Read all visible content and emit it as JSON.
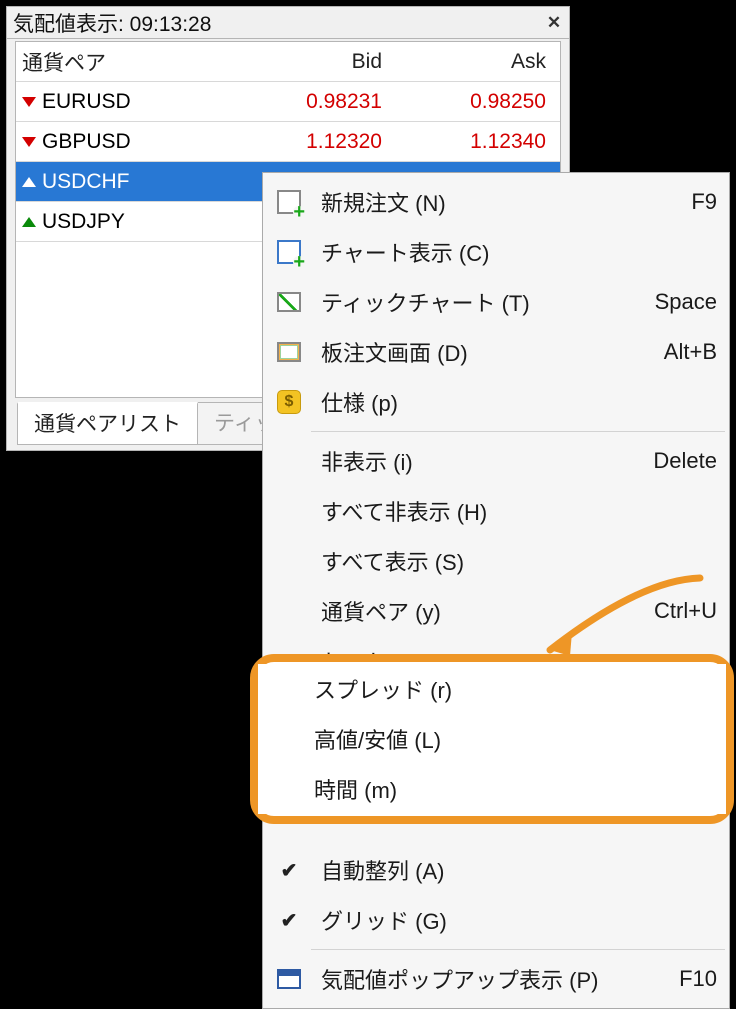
{
  "window": {
    "title": "気配値表示: 09:13:28"
  },
  "table": {
    "headers": {
      "symbol": "通貨ペア",
      "bid": "Bid",
      "ask": "Ask"
    },
    "rows": [
      {
        "symbol": "EURUSD",
        "bid": "0.98231",
        "ask": "0.98250",
        "direction": "down",
        "selected": false
      },
      {
        "symbol": "GBPUSD",
        "bid": "1.12320",
        "ask": "1.12340",
        "direction": "down",
        "selected": false
      },
      {
        "symbol": "USDCHF",
        "bid": "",
        "ask": "",
        "direction": "up",
        "selected": true
      },
      {
        "symbol": "USDJPY",
        "bid": "",
        "ask": "",
        "direction": "up",
        "selected": false
      }
    ]
  },
  "tabs": {
    "active": "通貨ペアリスト",
    "inactive": "ティッ"
  },
  "menu": {
    "items": [
      {
        "icon": "order-icon",
        "label": "新規注文 (N)",
        "shortcut": "F9"
      },
      {
        "icon": "chart-icon",
        "label": "チャート表示 (C)",
        "shortcut": ""
      },
      {
        "icon": "tick-icon",
        "label": "ティックチャート (T)",
        "shortcut": "Space"
      },
      {
        "icon": "dom-icon",
        "label": "板注文画面 (D)",
        "shortcut": "Alt+B"
      },
      {
        "icon": "spec-icon",
        "label": "仕様 (p)",
        "shortcut": ""
      }
    ],
    "group2": [
      {
        "label": "非表示 (i)",
        "shortcut": "Delete"
      },
      {
        "label": "すべて非表示 (H)",
        "shortcut": ""
      },
      {
        "label": "すべて表示 (S)",
        "shortcut": ""
      },
      {
        "label": "通貨ペア (y)",
        "shortcut": "Ctrl+U"
      },
      {
        "label": "セット",
        "submenu": true
      }
    ],
    "highlighted": [
      {
        "label": "スプレッド (r)"
      },
      {
        "label": "高値/安値 (L)"
      },
      {
        "label": "時間 (m)"
      }
    ],
    "group3": [
      {
        "checked": true,
        "label": "自動整列 (A)"
      },
      {
        "checked": true,
        "label": "グリッド (G)"
      }
    ],
    "group4": [
      {
        "icon": "popup-icon",
        "label": "気配値ポップアップ表示 (P)",
        "shortcut": "F10"
      }
    ]
  }
}
